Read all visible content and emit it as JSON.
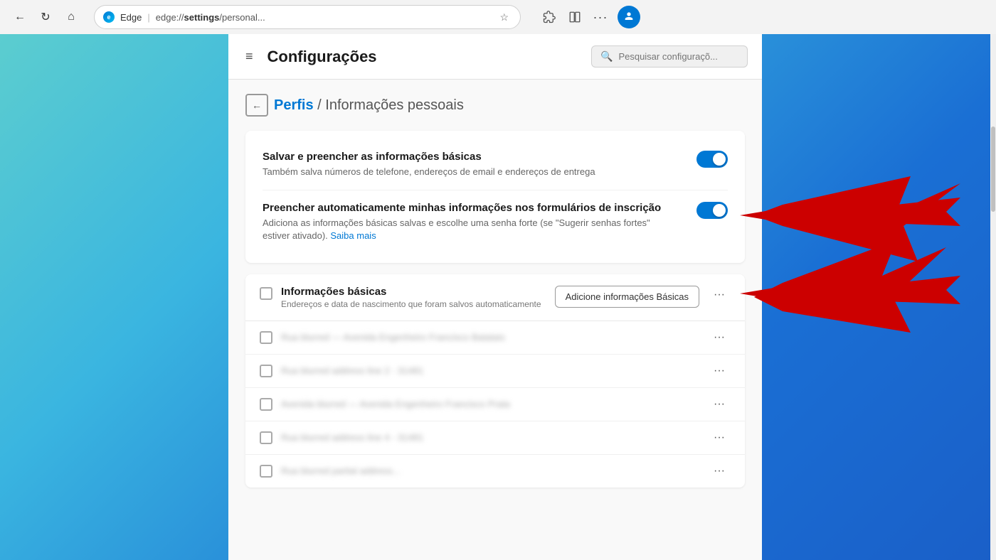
{
  "browser": {
    "back_btn": "←",
    "refresh_btn": "↻",
    "home_btn": "⌂",
    "edge_label": "Edge",
    "address_url": "edge://settings/personal...",
    "address_bold": "settings",
    "star_icon": "☆",
    "extensions_icon": "🧩",
    "split_icon": "⧉",
    "more_icon": "···",
    "profile_icon": "✦"
  },
  "settings": {
    "hamburger": "≡",
    "title": "Configurações",
    "search_placeholder": "Pesquisar configuraçõ...",
    "breadcrumb_link": "Perfis",
    "breadcrumb_separator": "/",
    "breadcrumb_current": "Informações pessoais",
    "back_arrow": "←"
  },
  "toggles": {
    "toggle1": {
      "title": "Salvar e preencher as informações básicas",
      "desc": "Também salva números de telefone, endereços de email e endereços de entrega",
      "enabled": true
    },
    "toggle2": {
      "title": "Preencher automaticamente minhas informações nos formulários de inscrição",
      "desc": "Adiciona as informações básicas salvas e escolhe uma senha forte (se \"Sugerir senhas fortes\" estiver ativado).",
      "desc_link": "Saiba mais",
      "enabled": true
    }
  },
  "basic_info": {
    "title": "Informações básicas",
    "desc": "Endereços e data de nascimento que foram salvos automaticamente",
    "add_button": "Adicione informações Básicas",
    "more_icon": "···",
    "rows": [
      {
        "id": 1,
        "text": "Rua blurred address line 1 - Avenida Engenheiro Francisco Batatais"
      },
      {
        "id": 2,
        "text": "Rua blurred address line 2 - 31481"
      },
      {
        "id": 3,
        "text": "Avenida blurred address line 3 - Avenida Engenheiro Francisco Prata"
      },
      {
        "id": 4,
        "text": "Rua blurred address line 4 - 31481"
      },
      {
        "id": 5,
        "text": "Rua blurred partial..."
      }
    ]
  }
}
